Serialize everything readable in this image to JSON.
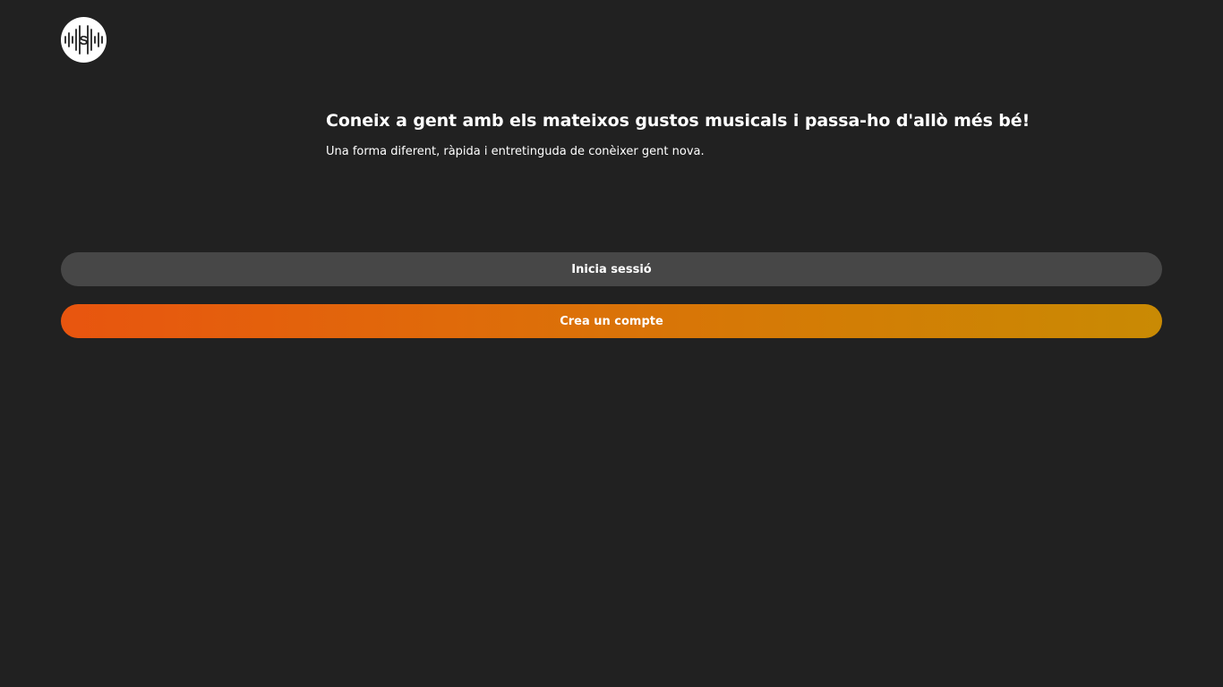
{
  "app": {
    "logo_icon": "soundwave-logo-icon",
    "logo_letter": "S"
  },
  "hero": {
    "title": "Coneix a gent amb els mateixos gustos musicals i passa-ho d'allò més bé!",
    "subtitle": "Una forma diferent, ràpida i entretinguda de conèixer gent nova."
  },
  "actions": {
    "login_label": "Inicia sessió",
    "signup_label": "Crea un compte"
  },
  "colors": {
    "background": "#212121",
    "login_button": "#474747",
    "signup_gradient_start": "#e8550f",
    "signup_gradient_end": "#c98a04"
  }
}
